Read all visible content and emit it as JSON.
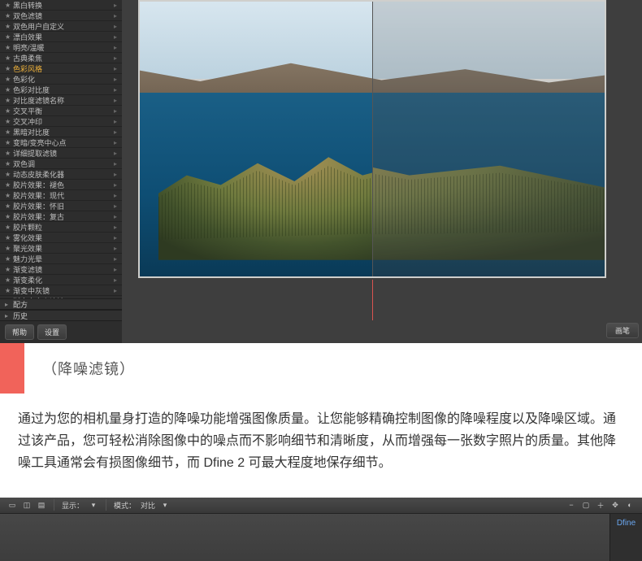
{
  "sidebar": {
    "presets": [
      {
        "label": "黑白转换",
        "selected": false
      },
      {
        "label": "双色滤镜",
        "selected": false
      },
      {
        "label": "双色用户自定义",
        "selected": false
      },
      {
        "label": "漂白效果",
        "selected": false
      },
      {
        "label": "明亮/温暖",
        "selected": false
      },
      {
        "label": "古典柔焦",
        "selected": false
      },
      {
        "label": "色彩风格",
        "selected": true
      },
      {
        "label": "色彩化",
        "selected": false
      },
      {
        "label": "色彩对比度",
        "selected": false
      },
      {
        "label": "对比度滤镜名称",
        "selected": false
      },
      {
        "label": "交叉平衡",
        "selected": false
      },
      {
        "label": "交叉冲印",
        "selected": false
      },
      {
        "label": "黑暗对比度",
        "selected": false
      },
      {
        "label": "变暗/变亮中心点",
        "selected": false
      },
      {
        "label": "详细提取滤镜",
        "selected": false
      },
      {
        "label": "双色调",
        "selected": false
      },
      {
        "label": "动态皮肤柔化器",
        "selected": false
      },
      {
        "label": "胶片效果：褪色",
        "selected": false
      },
      {
        "label": "胶片效果：现代",
        "selected": false
      },
      {
        "label": "胶片效果：怀旧",
        "selected": false
      },
      {
        "label": "胶片效果：复古",
        "selected": false
      },
      {
        "label": "胶片颗粒",
        "selected": false
      },
      {
        "label": "雾化效果",
        "selected": false
      },
      {
        "label": "聚光效果",
        "selected": false
      },
      {
        "label": "魅力光晕",
        "selected": false
      },
      {
        "label": "渐变滤镜",
        "selected": false
      },
      {
        "label": "渐变柔化",
        "selected": false
      },
      {
        "label": "渐变中灰镜",
        "selected": false
      },
      {
        "label": "渐变自定义滤镜",
        "selected": false
      }
    ],
    "group1": "配方",
    "group2": "历史",
    "btn_cancel": "帮助",
    "btn_settings": "设置"
  },
  "bottom_right_btn": "画笔",
  "desc": {
    "title": "（降噪滤镜）",
    "body": "通过为您的相机量身打造的降噪功能增强图像质量。让您能够精确控制图像的降噪程度以及降噪区域。通过该产品，您可轻松消除图像中的噪点而不影响细节和清晰度，从而增强每一张数字照片的质量。其他降噪工具通常会有损图像细节，而 Dfine 2 可最大程度地保存细节。"
  },
  "toolbar2": {
    "display_label": "显示：",
    "mode_label": "模式：",
    "mode_value": "对比",
    "panel_title": "Dfine"
  }
}
